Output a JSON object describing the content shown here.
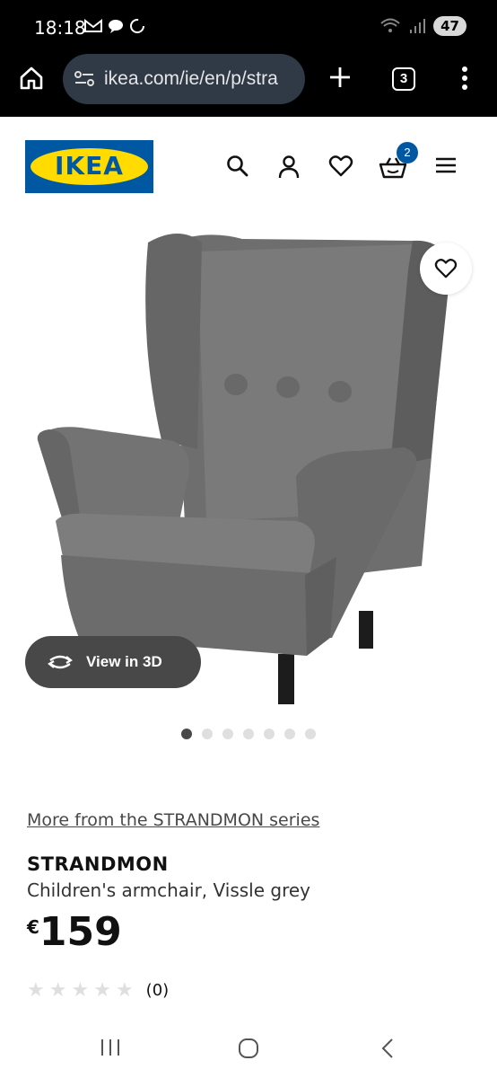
{
  "status_bar": {
    "time": "18:18",
    "battery": "47",
    "icons": [
      "gmail-icon",
      "chat-icon",
      "sync-icon",
      "wifi-icon",
      "signal-icon"
    ]
  },
  "browser": {
    "url": "ikea.com/ie/en/p/stra",
    "tab_count": "3",
    "icons": [
      "home-icon",
      "site-settings-icon",
      "new-tab-icon",
      "tabs-icon",
      "more-icon"
    ]
  },
  "header": {
    "logo_text": "IKEA",
    "basket_count": "2",
    "icons": [
      "search-icon",
      "account-icon",
      "wishlist-icon",
      "basket-icon",
      "menu-icon"
    ]
  },
  "gallery": {
    "view_3d_label": "View in 3D",
    "dots_total": 7,
    "active_dot": 1
  },
  "product": {
    "series_link": "More from the STRANDMON series",
    "name": "STRANDMON",
    "description": "Children's armchair, Vissle grey",
    "currency": "€",
    "price": "159",
    "rating_stars": 0,
    "rating_count": "(0)"
  },
  "colors": {
    "ikea_blue": "#0058a3",
    "ikea_yellow": "#ffdb00",
    "chair_grey": "#6f6f6f"
  }
}
